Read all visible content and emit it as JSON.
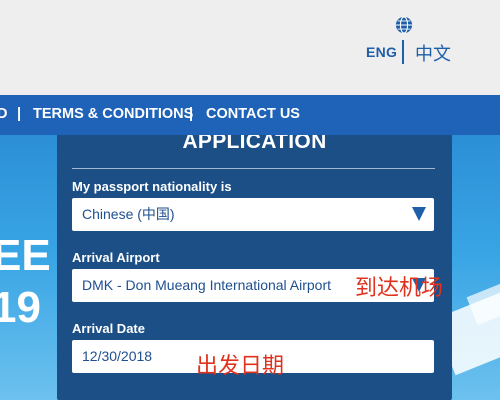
{
  "header": {
    "lang_en": "ENG",
    "lang_zh": "中文"
  },
  "nav": {
    "items": [
      "D",
      "TERMS & CONDITIONS",
      "CONTACT US"
    ],
    "separator": "|"
  },
  "hero": {
    "text_line1": "EE",
    "text_line2": "19"
  },
  "form": {
    "title": "APPLICATION",
    "nationality_label": "My passport nationality is",
    "nationality_value": "Chinese (中国)",
    "airport_label": "Arrival Airport",
    "airport_value": "DMK - Don Mueang International Airport",
    "date_label": "Arrival Date",
    "date_value": "12/30/2018"
  },
  "annotations": {
    "airport_note": "到达机场",
    "date_note": "出发日期"
  },
  "colors": {
    "brand_blue": "#1f63b8",
    "card_blue": "#1b4f86",
    "text_blue": "#1f5fa8",
    "annotation_red": "#e0321e"
  }
}
